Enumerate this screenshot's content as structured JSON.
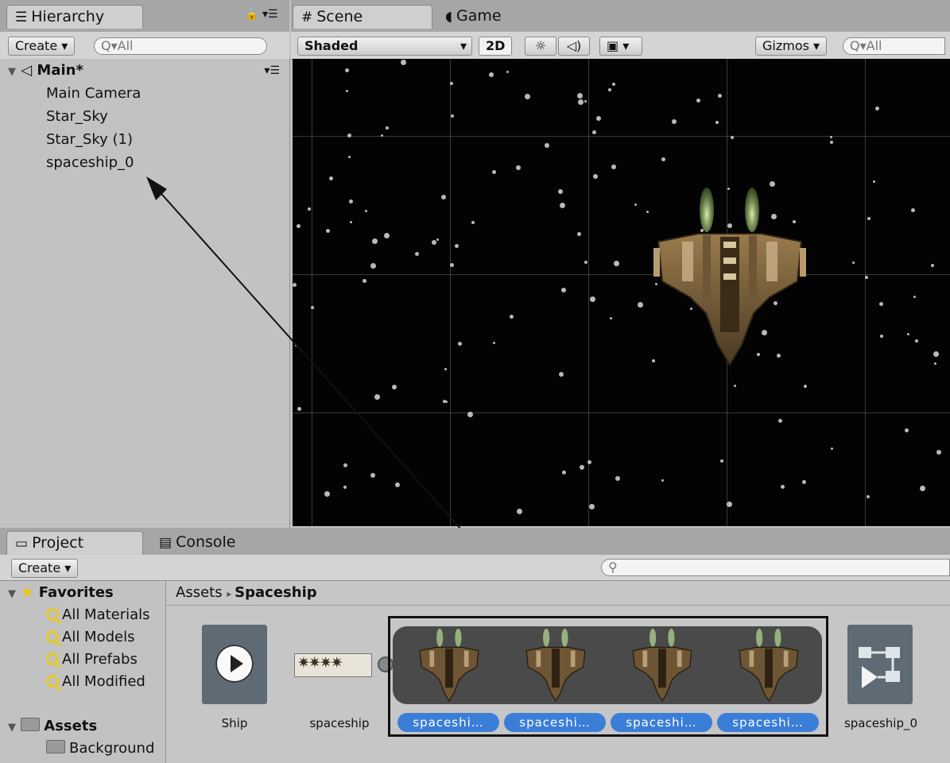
{
  "hierarchy": {
    "tab_label": "Hierarchy",
    "create_label": "Create",
    "search_placeholder": "Q▾All",
    "scene_name": "Main*",
    "items": [
      "Main Camera",
      "Star_Sky",
      "Star_Sky (1)",
      "spaceship_0"
    ]
  },
  "scene": {
    "tabs": [
      "Scene",
      "Game"
    ],
    "shading": "Shaded",
    "mode_2d": "2D",
    "gizmos_label": "Gizmos",
    "search_placeholder": "Q▾All"
  },
  "project": {
    "tabs": [
      "Project",
      "Console"
    ],
    "create_label": "Create",
    "favorites_label": "Favorites",
    "favorites": [
      "All Materials",
      "All Models",
      "All Prefabs",
      "All Modified"
    ],
    "assets_label": "Assets",
    "asset_folders": [
      "Background"
    ],
    "breadcrumb_root": "Assets",
    "breadcrumb_current": "Spaceship",
    "assets": {
      "ship_label": "Ship",
      "spritesheet_label": "spaceship",
      "sprite_labels": [
        "spaceshi…",
        "spaceshi…",
        "spaceshi…",
        "spaceshi…"
      ],
      "anim_label": "spaceship_0"
    }
  },
  "colors": {
    "selection_blue": "#3b7ed8",
    "panel_gray": "#c2c2c2",
    "scene_background": "#030303"
  }
}
